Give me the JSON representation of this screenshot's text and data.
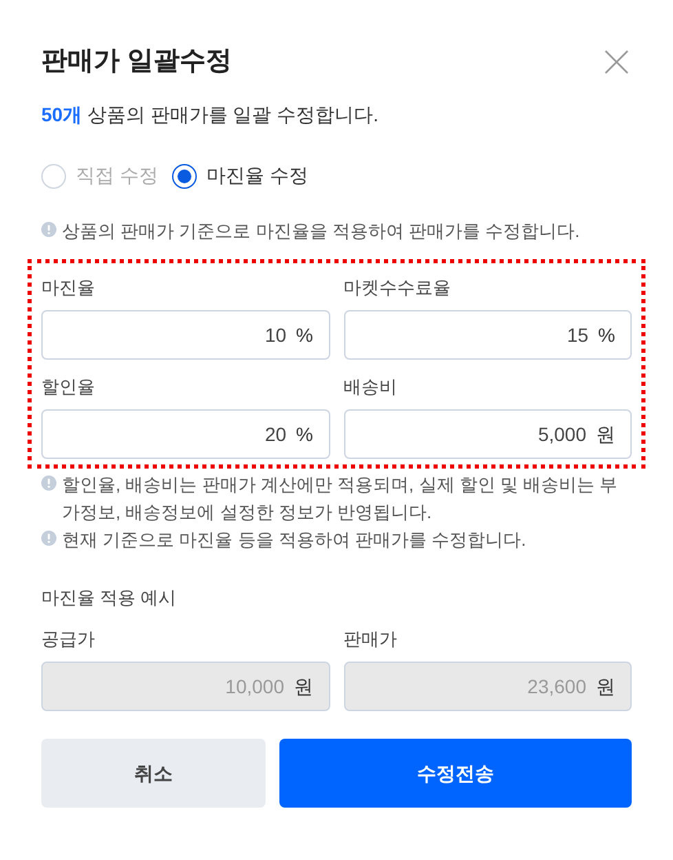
{
  "title": "판매가 일괄수정",
  "summary": "**50개** 상품의 판매가를 일괄 수정합니다.",
  "modes": [
    {
      "label": "직접 수정",
      "selected": false,
      "disabled": true
    },
    {
      "label": "마진율 수정",
      "selected": true,
      "disabled": false
    }
  ],
  "info": "상품의 판매가 기준으로 마진율을 적용하여 판매가를 수정합니다.",
  "fields": [
    {
      "label": "마진율",
      "value": "10",
      "unit": "%",
      "disabled": false
    },
    {
      "label": "마켓수수료율",
      "value": "15",
      "unit": "%",
      "disabled": false
    },
    {
      "label": "할인율",
      "value": "20",
      "unit": "%",
      "disabled": false
    },
    {
      "label": "배송비",
      "value": "5,000",
      "unit": "원",
      "disabled": false
    }
  ],
  "notes": [
    "할인율, 배송비는 판매가 계산에만 적용되며, 실제 할인 및 배송비는 부가정보, 배송정보에 설정한 정보가 반영됩니다.",
    "현재 기준으로 마진율 등을 적용하여 판매가를 수정합니다."
  ],
  "example": {
    "title": "마진율 적용 예시",
    "fields": [
      {
        "label": "공급가",
        "value": "10,000",
        "unit": "원",
        "disabled": true
      },
      {
        "label": "판매가",
        "value": "23,600",
        "unit": "원",
        "disabled": true
      }
    ]
  },
  "buttons": [
    {
      "label": "취소",
      "kind": "secondary"
    },
    {
      "label": "수정전송",
      "kind": "primary"
    }
  ]
}
